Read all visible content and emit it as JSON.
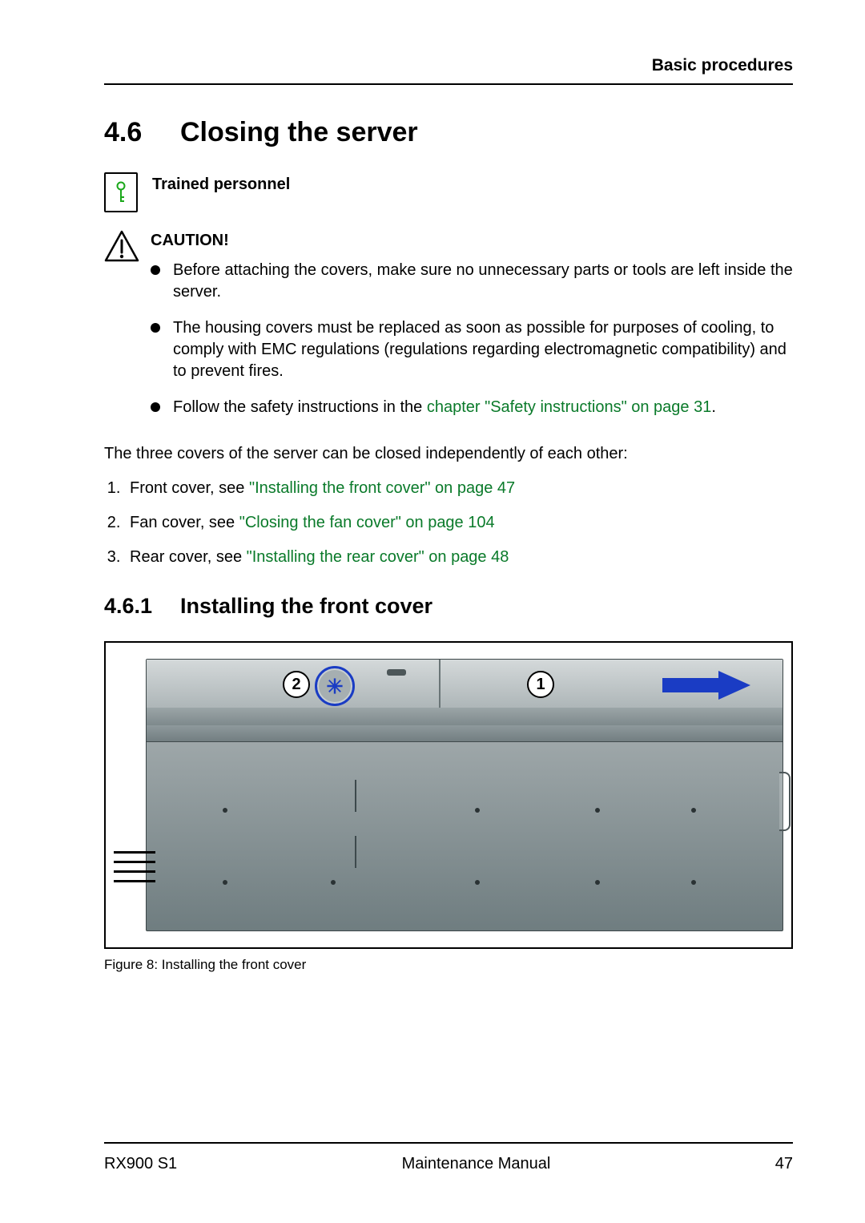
{
  "header": {
    "chapter": "Basic procedures"
  },
  "section": {
    "number": "4.6",
    "title": "Closing the server"
  },
  "personnel": {
    "label": "Trained personnel"
  },
  "caution": {
    "title": "CAUTION!",
    "items": [
      {
        "text_before": "Before attaching the covers, make sure no unnecessary parts or tools are left inside the server."
      },
      {
        "text_before": "The housing covers must be replaced as soon as possible for purposes of cooling, to comply with EMC regulations (regulations regarding electromagnetic compatibility) and to prevent fires."
      },
      {
        "text_before": "Follow the safety instructions in the ",
        "link": "chapter \"Safety instructions\" on page 31",
        "text_after": "."
      }
    ]
  },
  "intro": "The three covers of the server can be closed independently of each other:",
  "list": [
    {
      "text": "Front cover, see ",
      "link": "\"Installing the front cover\" on page 47"
    },
    {
      "text": "Fan cover, see ",
      "link": "\"Closing the fan cover\" on page 104"
    },
    {
      "text": "Rear cover, see ",
      "link": "\"Installing the rear cover\" on page 48"
    }
  ],
  "subsection": {
    "number": "4.6.1",
    "title": "Installing the front cover"
  },
  "figure": {
    "badges": {
      "left": "2",
      "right": "1"
    },
    "caption": "Figure 8: Installing the front cover"
  },
  "footer": {
    "model": "RX900 S1",
    "doc": "Maintenance Manual",
    "page": "47"
  }
}
